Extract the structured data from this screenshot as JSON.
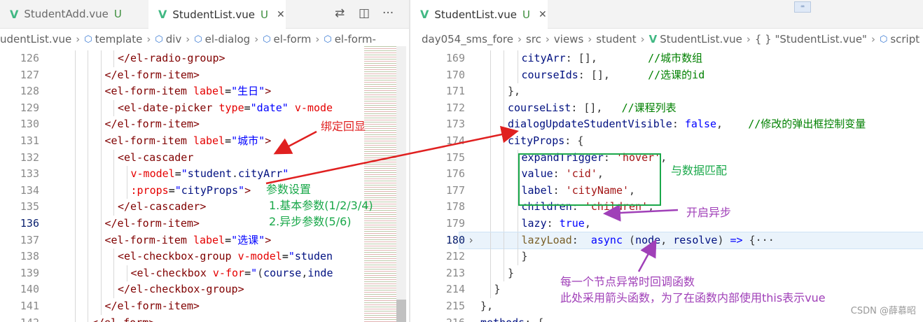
{
  "left": {
    "tabs": [
      {
        "label": "StudentAdd.vue",
        "status": "U",
        "active": false
      },
      {
        "label": "StudentList.vue",
        "status": "U",
        "active": true
      }
    ],
    "breadcrumb": [
      "udentList.vue",
      "template",
      "div",
      "el-dialog",
      "el-form",
      "el-form-"
    ],
    "lines": [
      {
        "n": "126",
        "indent": 4,
        "html": "<span class='t'>&lt;/el-radio-group&gt;</span>"
      },
      {
        "n": "127",
        "indent": 3,
        "html": "<span class='t'>&lt;/el-form-item&gt;</span>"
      },
      {
        "n": "128",
        "indent": 3,
        "html": "<span class='t'>&lt;el-form-item</span> <span class='a'>label</span>=<span class='s'>\"生日\"</span><span class='t'>&gt;</span>"
      },
      {
        "n": "129",
        "indent": 4,
        "html": "<span class='t'>&lt;el-date-picker</span> <span class='a'>type</span>=<span class='s'>\"date\"</span> <span class='a'>v-mode</span>"
      },
      {
        "n": "130",
        "indent": 3,
        "html": "<span class='t'>&lt;/el-form-item&gt;</span>"
      },
      {
        "n": "131",
        "indent": 3,
        "html": "<span class='t'>&lt;el-form-item</span> <span class='a'>label</span>=<span class='s'>\"城市\"</span><span class='t'>&gt;</span>"
      },
      {
        "n": "132",
        "indent": 4,
        "html": "<span class='t'>&lt;el-cascader</span>"
      },
      {
        "n": "133",
        "indent": 5,
        "html": "<span class='a'>v-model</span>=<span class='s'>\"</span><span class='k'>student</span><span class='p'>.</span><span class='k'>cityArr</span><span class='s'>\"</span>"
      },
      {
        "n": "134",
        "indent": 5,
        "html": "<span class='a'>:props</span>=<span class='s'>\"</span><span class='k'>cityProps</span><span class='s'>\"</span><span class='t'>&gt;</span>"
      },
      {
        "n": "135",
        "indent": 4,
        "html": "<span class='t'>&lt;/el-cascader&gt;</span>"
      },
      {
        "n": "136",
        "indent": 3,
        "html": "<span class='t'>&lt;/el-form-item&gt;</span>",
        "current": true
      },
      {
        "n": "137",
        "indent": 3,
        "html": "<span class='t'>&lt;el-form-item</span> <span class='a'>label</span>=<span class='s'>\"选课\"</span><span class='t'>&gt;</span>"
      },
      {
        "n": "138",
        "indent": 4,
        "html": "<span class='t'>&lt;el-checkbox-group</span> <span class='a'>v-model</span>=<span class='s'>\"</span><span class='k'>studen</span>"
      },
      {
        "n": "139",
        "indent": 5,
        "html": "<span class='t'>&lt;el-checkbox</span> <span class='a'>v-for</span>=<span class='s'>\"</span><span class='p'>(</span><span class='k'>course</span><span class='p'>,</span><span class='k'>inde</span>"
      },
      {
        "n": "140",
        "indent": 4,
        "html": "<span class='t'>&lt;/el-checkbox-group&gt;</span>"
      },
      {
        "n": "141",
        "indent": 3,
        "html": "<span class='t'>&lt;/el-form-item&gt;</span>"
      },
      {
        "n": "142",
        "indent": 2,
        "html": "<span class='t'>&lt;/el-form&gt;</span>"
      }
    ]
  },
  "right": {
    "tabs": [
      {
        "label": "StudentList.vue",
        "status": "U",
        "active": true
      }
    ],
    "breadcrumb": [
      "day054_sms_fore",
      "src",
      "views",
      "student",
      "StudentList.vue",
      "{ } \"StudentList.vue\"",
      "script"
    ],
    "lines": [
      {
        "n": "169",
        "indent": 3,
        "html": "<span class='k'>cityArr</span><span class='p'>: [],</span>        <span class='c'>//城市数组</span>"
      },
      {
        "n": "170",
        "indent": 3,
        "html": "<span class='k'>courseIds</span><span class='p'>: [],</span>      <span class='c'>//选课的id</span>"
      },
      {
        "n": "171",
        "indent": 2,
        "html": "<span class='p'>},</span>"
      },
      {
        "n": "172",
        "indent": 2,
        "html": "<span class='k'>courseList</span><span class='p'>: [],</span>   <span class='c'>//课程列表</span>"
      },
      {
        "n": "173",
        "indent": 2,
        "html": "<span class='k'>dialogUpdateStudentVisible</span><span class='p'>: </span><span class='kw'>false</span><span class='p'>,</span>    <span class='c'>//修改的弹出框控制变量</span>"
      },
      {
        "n": "174",
        "indent": 2,
        "html": "<span class='k'>cityProps</span><span class='p'>: {</span>"
      },
      {
        "n": "175",
        "indent": 3,
        "html": "<span class='k'>expandTrigger</span><span class='p'>: </span><span class='str'>'hover'</span><span class='p'>,</span>"
      },
      {
        "n": "176",
        "indent": 3,
        "html": "<span class='k'>value</span><span class='p'>: </span><span class='str'>'cid'</span><span class='p'>,</span>"
      },
      {
        "n": "177",
        "indent": 3,
        "html": "<span class='k'>label</span><span class='p'>: </span><span class='str'>'cityName'</span><span class='p'>,</span>"
      },
      {
        "n": "178",
        "indent": 3,
        "html": "<span class='k'>children</span><span class='p'>: </span><span class='str'>'children'</span><span class='p'>,</span>"
      },
      {
        "n": "179",
        "indent": 3,
        "html": "<span class='k'>lazy</span><span class='p'>: </span><span class='kw'>true</span><span class='p'>,</span>"
      },
      {
        "n": "180",
        "indent": 3,
        "html": "<span class='fn'>lazyLoad</span><span class='p'>:  </span><span class='kw'>async</span> <span class='p'>(</span><span class='k'>node</span><span class='p'>, </span><span class='k'>resolve</span><span class='p'>) </span><span class='kw'>=&gt;</span><span class='p'> {</span><span class='p'>···</span>",
        "folded": true
      },
      {
        "n": "212",
        "indent": 3,
        "html": "<span class='p'>}</span>"
      },
      {
        "n": "213",
        "indent": 2,
        "html": "<span class='p'>}</span>"
      },
      {
        "n": "214",
        "indent": 1,
        "html": "<span class='p'>}</span>"
      },
      {
        "n": "215",
        "indent": 0,
        "html": "<span class='p'>},</span>"
      },
      {
        "n": "216",
        "indent": 0,
        "html": "<span class='k'>methods</span><span class='p'>: {</span>"
      }
    ]
  },
  "annotations": {
    "bind_echo": "绑定回显",
    "params": "参数设置",
    "basic": "1.基本参数(1/2/3/4)",
    "async_params": "2.异步参数(5/6)",
    "match": "与数据匹配",
    "enable_async": "开启异步",
    "callback_1": "每一个节点异常时回调函数",
    "callback_2": "此处采用箭头函数，为了在函数内部使用this表示vue"
  },
  "watermark": "CSDN @薛慕昭",
  "colors": {
    "annotation_red": "#e02020",
    "annotation_green": "#1aa84a",
    "annotation_purple": "#a040b8",
    "vue_green": "#41b883"
  }
}
